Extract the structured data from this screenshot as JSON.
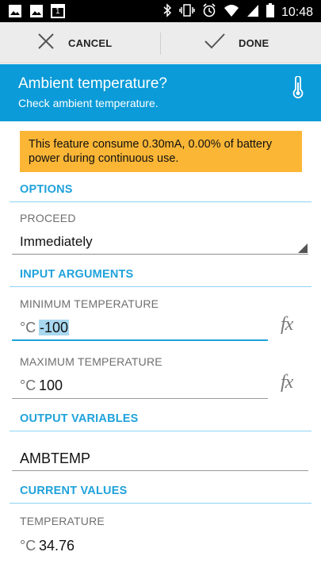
{
  "status_bar": {
    "time": "10:48",
    "left_icons": [
      "image-icon",
      "image-icon",
      "calendar-icon"
    ],
    "calendar_day": "1",
    "right_icons": [
      "bluetooth-icon",
      "vibrate-icon",
      "alarm-icon",
      "wifi-icon",
      "signal-icon",
      "battery-icon"
    ]
  },
  "action_bar": {
    "cancel_label": "CANCEL",
    "done_label": "DONE"
  },
  "header": {
    "title": "Ambient temperature?",
    "subtitle": "Check ambient temperature.",
    "icon": "thermometer-icon",
    "color": "#0a9bd8"
  },
  "warning": {
    "text": "This feature consume 0.30mA, 0.00% of battery power during continuous use.",
    "color": "#fbb636"
  },
  "options": {
    "heading": "OPTIONS",
    "proceed_label": "PROCEED",
    "proceed_value": "Immediately"
  },
  "input_arguments": {
    "heading": "INPUT ARGUMENTS",
    "min_label": "MINIMUM TEMPERATURE",
    "min_unit": "°C",
    "min_value": "-100",
    "max_label": "MAXIMUM TEMPERATURE",
    "max_unit": "°C",
    "max_value": "100",
    "fx_label": "fx"
  },
  "output_variables": {
    "heading": "OUTPUT VARIABLES",
    "value": "AMBTEMP"
  },
  "current_values": {
    "heading": "CURRENT VALUES",
    "temp_label": "TEMPERATURE",
    "temp_unit": "°C",
    "temp_value": "34.76"
  },
  "colors": {
    "accent": "#1fa2db",
    "divider": "#8dd3f1"
  }
}
